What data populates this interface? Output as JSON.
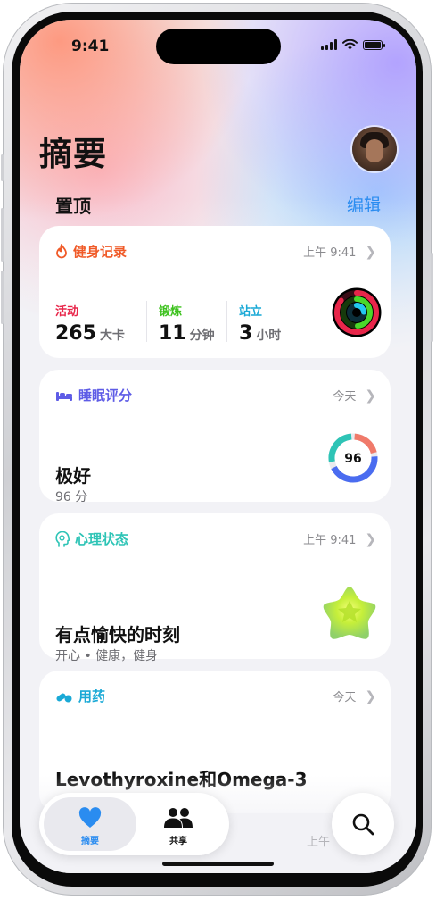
{
  "status_bar": {
    "time": "9:41"
  },
  "header": {
    "title": "摘要"
  },
  "pinned": {
    "label": "置顶",
    "edit_label": "编辑"
  },
  "activity_card": {
    "title": "健身记录",
    "time": "上午 9:41",
    "metrics": [
      {
        "label": "活动",
        "value": "265",
        "unit": "大卡",
        "color": "#e8264a"
      },
      {
        "label": "锻炼",
        "value": "11",
        "unit": "分钟",
        "color": "#3ec21f"
      },
      {
        "label": "站立",
        "value": "3",
        "unit": "小时",
        "color": "#1aa9d6"
      }
    ]
  },
  "sleep_card": {
    "title": "睡眠评分",
    "time": "今天",
    "rating": "极好",
    "score_text": "96 分",
    "score": "96"
  },
  "mind_card": {
    "title": "心理状态",
    "time": "上午 9:41",
    "mood": "有点愉快的时刻",
    "tags": "开心 • 健康，健身"
  },
  "meds_card": {
    "title": "用药",
    "time": "今天",
    "meds": "Levothyroxine和Omega-3"
  },
  "peek_card": {
    "time": "上午"
  },
  "tab_bar": {
    "summary_label": "摘要",
    "sharing_label": "共享"
  },
  "colors": {
    "accent": "#2a8cf0",
    "activity": "#f05a28",
    "sleep": "#5e5ce6",
    "mind": "#2ec4b6",
    "meds": "#1aa9d6"
  }
}
